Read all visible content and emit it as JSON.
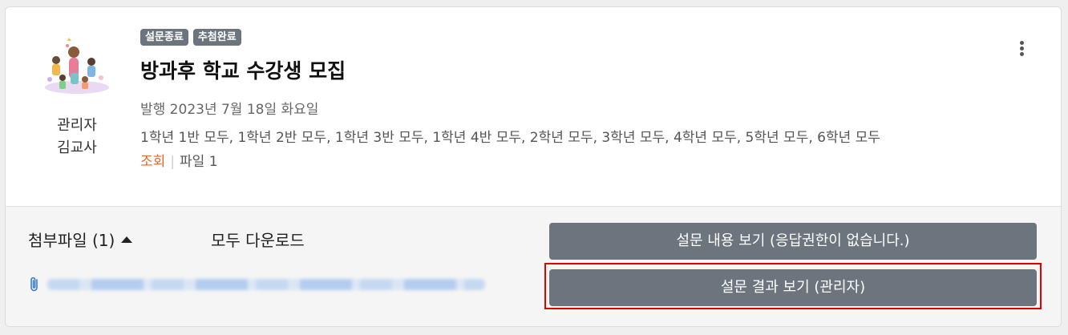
{
  "survey": {
    "badges": [
      "설문종료",
      "추첨완료"
    ],
    "title": "방과후 학교 수강생 모집",
    "published": "발행 2023년 7월 18일 화요일",
    "targets": "1학년 1반 모두, 1학년 2반 모두, 1학년 3반 모두, 1학년 4반 모두, 2학년 모두, 3학년 모두, 4학년 모두, 5학년 모두, 6학년 모두",
    "views_label": "조회",
    "files_label": "파일 1"
  },
  "author": {
    "role": "관리자",
    "name": "김교사"
  },
  "attachments": {
    "header": "첨부파일 (1)",
    "download_all": "모두 다운로드"
  },
  "actions": {
    "view_survey": "설문 내용 보기 (응답권한이 없습니다.)",
    "view_results": "설문 결과 보기 (관리자)"
  },
  "colors": {
    "badge": "#6c757d",
    "button": "#6c757d",
    "views": "#e06a2b",
    "highlight": "#e00000"
  }
}
